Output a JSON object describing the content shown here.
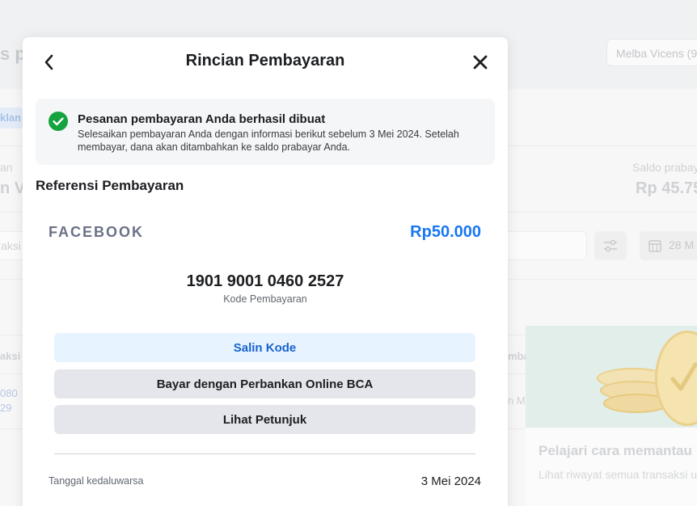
{
  "background": {
    "page_title": "s p",
    "account_selector": "Melba Vicens (9",
    "tab_label": "klan",
    "col_left_label": "an",
    "col_left_value": "n Vi",
    "col_right_label": "Saldo prabay",
    "col_right_value": "Rp 45.75",
    "search_placeholder": "aksi",
    "date_filter": "28 M",
    "table_header_left": "aksi",
    "table_header_right": "mba",
    "row_link_1": "080",
    "row_link_2": "29",
    "row_text": "n M",
    "promo_title": "Pelajari cara memantau",
    "promo_subtitle": "Lihat riwayat semua transaksi u"
  },
  "modal": {
    "title": "Rincian Pembayaran",
    "notice": {
      "title": "Pesanan pembayaran Anda berhasil dibuat",
      "body": "Selesaikan pembayaran Anda dengan informasi berikut sebelum 3 Mei 2024. Setelah membayar, dana akan ditambahkan ke saldo prabayar Anda."
    },
    "reference_heading": "Referensi Pembayaran",
    "merchant": "FACEBOOK",
    "amount": "Rp50.000",
    "payment_code": "1901 9001 0460 2527",
    "payment_code_label": "Kode Pembayaran",
    "buttons": {
      "copy_code": "Salin Kode",
      "pay_online_bca": "Bayar dengan Perbankan Online BCA",
      "view_instructions": "Lihat Petunjuk"
    },
    "expiry_label": "Tanggal kedaluwarsa",
    "expiry_value": "3 Mei 2024"
  },
  "colors": {
    "accent": "#1877f2",
    "success": "#15a340",
    "copy_button_bg": "#e7f3ff",
    "secondary_button_bg": "#e4e6eb"
  }
}
